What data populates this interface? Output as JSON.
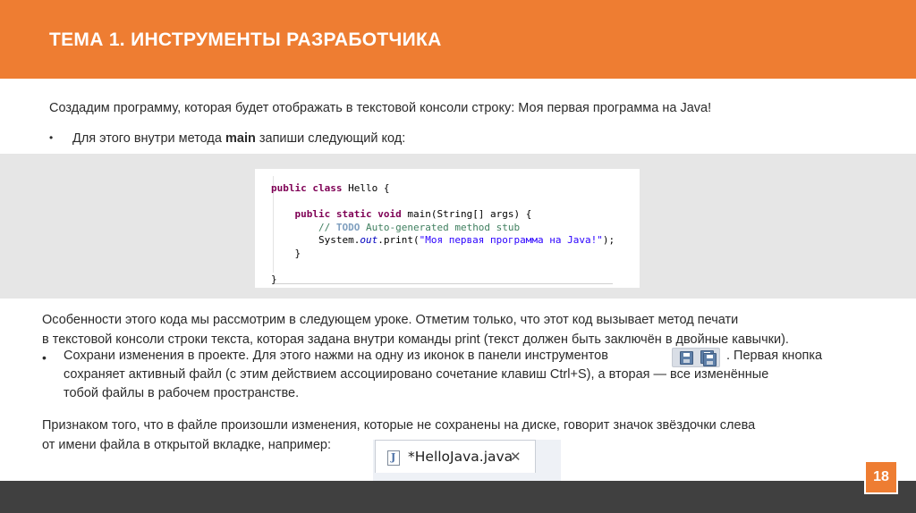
{
  "header": {
    "title": "ТЕМА 1. ИНСТРУМЕНТЫ РАЗРАБОТЧИКА"
  },
  "intro": {
    "text": "Создадим программу, которая будет отображать в текстовой консоли строку: ",
    "highlight": "Моя первая программа на Java!"
  },
  "bullet1": {
    "bullet": "•",
    "before": "Для этого внутри метода ",
    "bold": "main",
    "after": " запиши следующий код:"
  },
  "code": {
    "line1_kw": "public class",
    "line1_rest": " Hello {",
    "line3_kw": "public static void",
    "line3_rest": " main(String[] args) {",
    "line4_comment_start": "// ",
    "line4_tag": "TODO",
    "line4_comment_rest": " Auto-generated method stub",
    "line5_a": "System.",
    "line5_field": "out",
    "line5_b": ".print(",
    "line5_str": "\"Моя первая программа на Java!\"",
    "line5_c": ");",
    "line6": "}",
    "line8": "}"
  },
  "para1": {
    "line1": "Особенности этого кода мы рассмотрим в следующем уроке. Отметим только, что этот код вызывает метод печати",
    "line2": "в текстовой консоли строки текста, которая задана внутри команды print (текст должен быть заключён в двойные кавычки)."
  },
  "bullet2": {
    "bullet": "•",
    "line1_a": "Сохрани изменения в проекте. Для этого нажми на одну из иконок в панели инструментов",
    "line1_b": ". Первая кнопка",
    "line2": "сохраняет активный файл (с этим действием ассоциировано сочетание клавиш Ctrl+S), а вторая — все изменённые",
    "line3": "тобой файлы в рабочем пространстве."
  },
  "para2": {
    "line1": "Признаком того, что в файле произошли изменения, которые не сохранены на диске, говорит значок звёздочки слева",
    "line2": "от имени файла в открытой вкладке, например:"
  },
  "tab_example": {
    "name": "*HelloJava.java",
    "close": "✕",
    "icon_letter": "J"
  },
  "icons": [
    "save-icon",
    "save-all-icon",
    "java-file-icon",
    "close-icon"
  ],
  "colors": {
    "accent": "#ee7d32",
    "footer": "#404040",
    "band": "#e6e6e6"
  },
  "footer": {
    "page_number": "18"
  }
}
